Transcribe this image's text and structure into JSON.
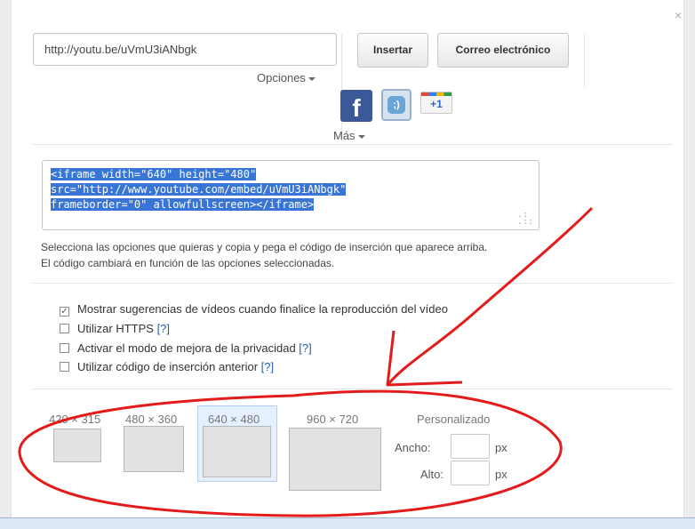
{
  "dialog": {
    "close_symbol": "×"
  },
  "share": {
    "url": "http://youtu.be/uVmU3iANbgk",
    "options_label": "Opciones",
    "insert_label": "Insertar",
    "email_label": "Correo electrónico",
    "facebook_glyph": "f",
    "tuenti_glyph": ";)",
    "gplus_label": "+1",
    "more_label": "Más"
  },
  "embed": {
    "code_lines": [
      "<iframe width=\"640\" height=\"480\"",
      "src=\"http://www.youtube.com/embed/uVmU3iANbgk\"",
      "frameborder=\"0\" allowfullscreen></iframe>"
    ],
    "help_line1": "Selecciona las opciones que quieras y copia y pega el código de inserción que aparece arriba.",
    "help_line2": "El código cambiará en función de las opciones seleccionadas."
  },
  "options": [
    {
      "label": "Mostrar sugerencias de vídeos cuando finalice la reproducción del vídeo",
      "checked": true,
      "help": ""
    },
    {
      "label": "Utilizar HTTPS ",
      "checked": false,
      "help": "[?]"
    },
    {
      "label": "Activar el modo de mejora de la privacidad ",
      "checked": false,
      "help": "[?]"
    },
    {
      "label": "Utilizar código de inserción anterior ",
      "checked": false,
      "help": "[?]"
    }
  ],
  "sizes": {
    "presets": [
      "420 × 315",
      "480 × 360",
      "640 × 480",
      "960 × 720"
    ],
    "selected": "640 × 480",
    "custom_label": "Personalizado",
    "width_label": "Ancho:",
    "height_label": "Alto:",
    "unit": "px"
  },
  "annotation": {
    "color": "#e31b1b"
  }
}
